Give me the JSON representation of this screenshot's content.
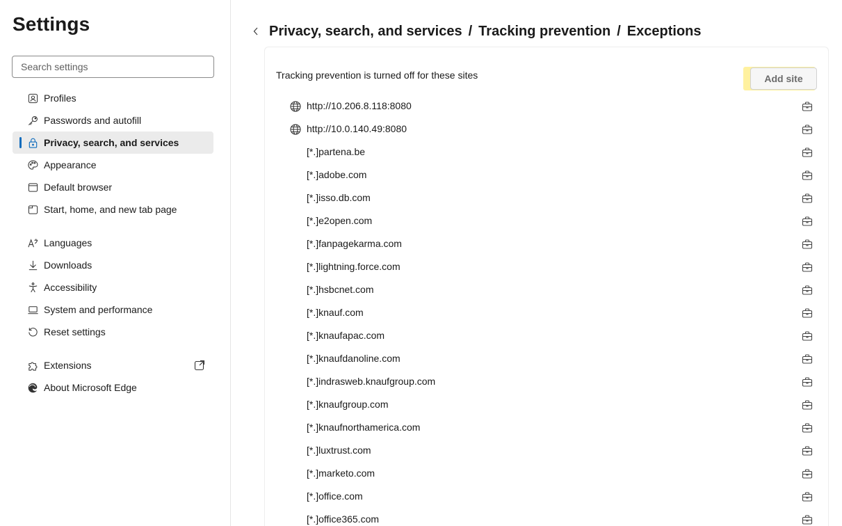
{
  "sidebar": {
    "title": "Settings",
    "search_placeholder": "Search settings",
    "items": [
      {
        "label": "Profiles",
        "icon": "profile-icon"
      },
      {
        "label": "Passwords and autofill",
        "icon": "key-icon"
      },
      {
        "label": "Privacy, search, and services",
        "icon": "lock-icon",
        "active": true
      },
      {
        "label": "Appearance",
        "icon": "palette-icon"
      },
      {
        "label": "Default browser",
        "icon": "browser-icon"
      },
      {
        "label": "Start, home, and new tab page",
        "icon": "home-tab-icon"
      },
      {
        "label": "Languages",
        "icon": "language-icon"
      },
      {
        "label": "Downloads",
        "icon": "download-icon"
      },
      {
        "label": "Accessibility",
        "icon": "accessibility-icon"
      },
      {
        "label": "System and performance",
        "icon": "laptop-icon"
      },
      {
        "label": "Reset settings",
        "icon": "reset-icon"
      },
      {
        "label": "Extensions",
        "icon": "puzzle-icon"
      },
      {
        "label": "About Microsoft Edge",
        "icon": "edge-icon"
      }
    ]
  },
  "main": {
    "breadcrumb": [
      "Privacy, search, and services",
      "Tracking prevention",
      "Exceptions"
    ],
    "breadcrumb_separator": "/",
    "card_heading": "Tracking prevention is turned off for these sites",
    "add_site_label": "Add site",
    "sites": [
      {
        "text": "http://10.206.8.118:8080",
        "globe": true
      },
      {
        "text": "http://10.0.140.49:8080",
        "globe": true
      },
      {
        "text": "[*.]partena.be",
        "globe": false
      },
      {
        "text": "[*.]adobe.com",
        "globe": false
      },
      {
        "text": "[*.]isso.db.com",
        "globe": false
      },
      {
        "text": "[*.]e2open.com",
        "globe": false
      },
      {
        "text": "[*.]fanpagekarma.com",
        "globe": false
      },
      {
        "text": "[*.]lightning.force.com",
        "globe": false
      },
      {
        "text": "[*.]hsbcnet.com",
        "globe": false
      },
      {
        "text": "[*.]knauf.com",
        "globe": false
      },
      {
        "text": "[*.]knaufapac.com",
        "globe": false
      },
      {
        "text": "[*.]knaufdanoline.com",
        "globe": false
      },
      {
        "text": "[*.]indrasweb.knaufgroup.com",
        "globe": false
      },
      {
        "text": "[*.]knaufgroup.com",
        "globe": false
      },
      {
        "text": "[*.]knaufnorthamerica.com",
        "globe": false
      },
      {
        "text": "[*.]luxtrust.com",
        "globe": false
      },
      {
        "text": "[*.]marketo.com",
        "globe": false
      },
      {
        "text": "[*.]office.com",
        "globe": false
      },
      {
        "text": "[*.]office365.com",
        "globe": false
      }
    ]
  },
  "colors": {
    "accent": "#0f6cbd",
    "highlight": "#ffe650",
    "active_bg": "#ebebeb"
  }
}
